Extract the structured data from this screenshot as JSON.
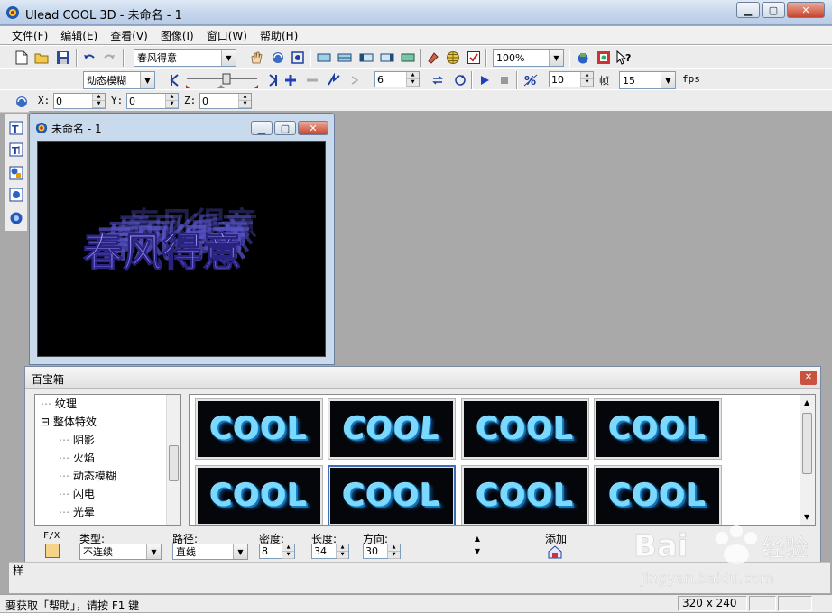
{
  "window": {
    "title": "Ulead COOL 3D - 未命名 - 1"
  },
  "menu": [
    "文件(F)",
    "编辑(E)",
    "查看(V)",
    "图像(I)",
    "窗口(W)",
    "帮助(H)"
  ],
  "toolbar1": {
    "text_combo": "春风得意",
    "zoom_combo": "100%"
  },
  "toolbar2": {
    "effect_combo": "动态模糊",
    "frame_spin": "6",
    "speed_spin": "10",
    "frame_label": "帧",
    "fps_combo": "15",
    "fps_label": "fps"
  },
  "toolbar3": {
    "x_label": "X:",
    "x_value": "0",
    "y_label": "Y:",
    "y_value": "0",
    "z_label": "Z:",
    "z_value": "0"
  },
  "child_window": {
    "title": "未命名 - 1",
    "canvas_text": "春风得意"
  },
  "panel": {
    "title": "百宝箱",
    "tree": [
      {
        "label": "纹理",
        "indent": 2
      },
      {
        "label": "整体特效",
        "indent": 1,
        "expander": "⊟"
      },
      {
        "label": "阴影",
        "indent": 2
      },
      {
        "label": "火焰",
        "indent": 2
      },
      {
        "label": "动态模糊",
        "indent": 2
      },
      {
        "label": "闪电",
        "indent": 2
      },
      {
        "label": "光晕",
        "indent": 2
      }
    ],
    "thumbnails": [
      "COOL",
      "COOL",
      "COOL",
      "COOL",
      "COOL",
      "COOL",
      "COOL",
      "COOL"
    ],
    "fx_label": "F/X",
    "type_label": "类型:",
    "type_value": "不连续",
    "path_label": "路径:",
    "path_value": "直线",
    "density_label": "密度:",
    "density_value": "8",
    "length_label": "长度:",
    "length_value": "34",
    "direction_label": "方向:",
    "direction_value": "30",
    "add_label": "添加"
  },
  "sample_label": "样",
  "status": {
    "help_text": "要获取「帮助」，请按 F1 键",
    "dimensions": "320 x 240"
  },
  "watermark": {
    "brand": "Bai",
    "brand2": "经验",
    "url": "jingyan.baidu.com"
  },
  "colors": {
    "canvas_text": "#6e6ae6",
    "thumb_text": "#7bd9ff",
    "accent": "#3d6fb8"
  }
}
